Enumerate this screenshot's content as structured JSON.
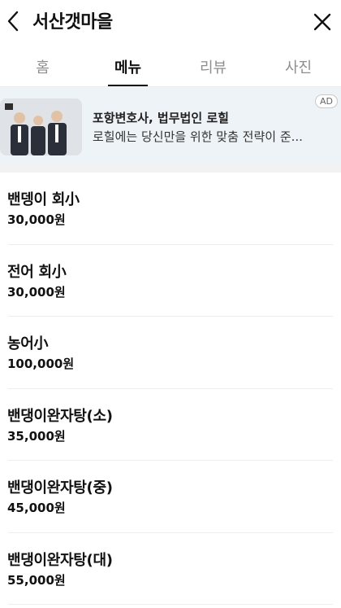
{
  "header": {
    "title": "서산갯마을",
    "back_icon": "chevron-left-icon",
    "close_icon": "close-icon"
  },
  "tabs": [
    {
      "label": "홈",
      "active": false
    },
    {
      "label": "메뉴",
      "active": true
    },
    {
      "label": "리뷰",
      "active": false
    },
    {
      "label": "사진",
      "active": false
    }
  ],
  "ad": {
    "title": "포항변호사, 법무법인 로힐",
    "description": "로힐에는 당신만을 위한 맞춤 전략이 준...",
    "badge": "AD"
  },
  "menu": [
    {
      "name": "밴뎅이 회小",
      "price": "30,000원"
    },
    {
      "name": "전어 회小",
      "price": "30,000원"
    },
    {
      "name": "농어小",
      "price": "100,000원"
    },
    {
      "name": "밴댕이완자탕(소)",
      "price": "35,000원"
    },
    {
      "name": "밴댕이완자탕(중)",
      "price": "45,000원"
    },
    {
      "name": "밴댕이완자탕(대)",
      "price": "55,000원"
    }
  ],
  "colors": {
    "active_tab": "#111111",
    "inactive_tab": "#8e8e8e",
    "ad_bg": "#eef3f8"
  }
}
